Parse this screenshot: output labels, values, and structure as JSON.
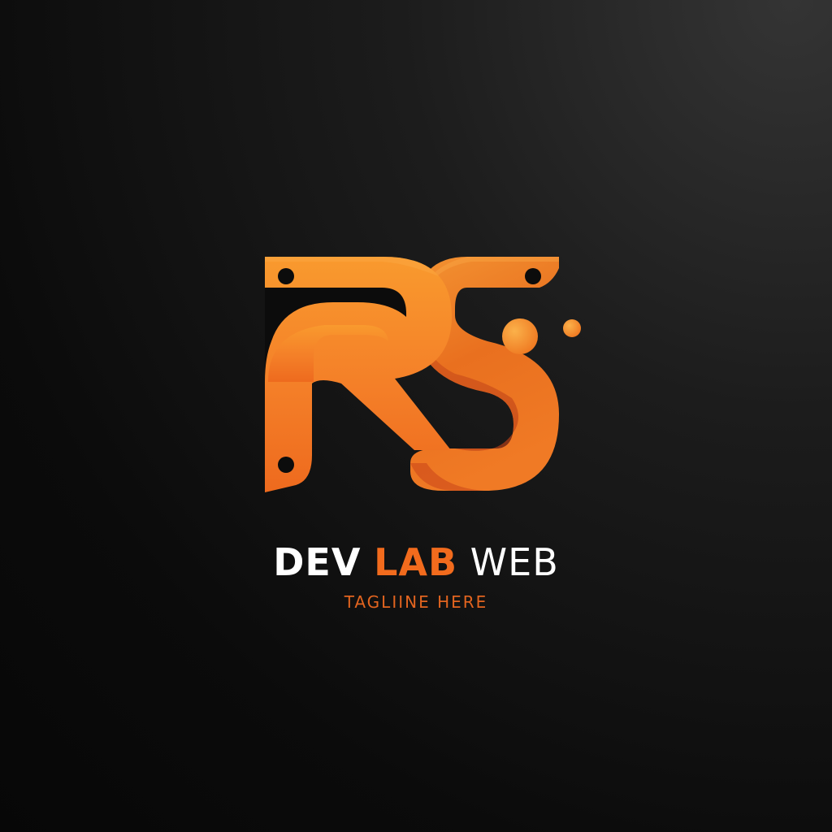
{
  "brand": {
    "monogram": "RS",
    "name_part1": "DEV",
    "name_part2": "LAB",
    "name_part3": "WEB",
    "tagline": "TAGLIINE HERE"
  },
  "colors": {
    "background": "#0b0b0b",
    "accent_light": "#f7a035",
    "accent": "#f26b1d",
    "accent_dark": "#c8401a",
    "text_white": "#ffffff"
  }
}
